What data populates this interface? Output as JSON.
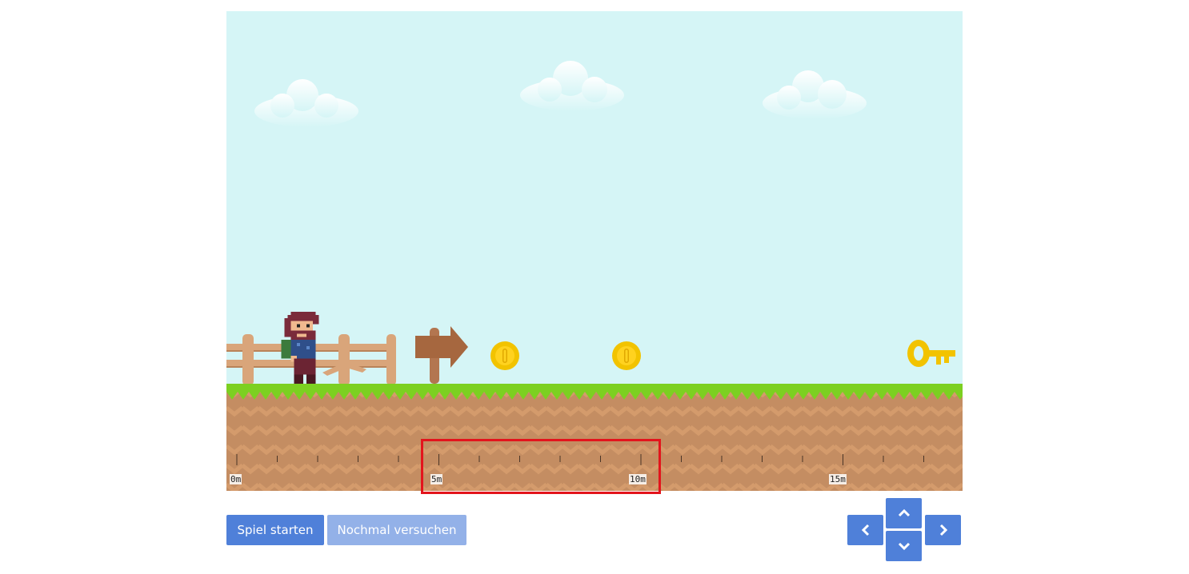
{
  "game": {
    "ruler": {
      "unit": "m",
      "labels": [
        {
          "text": "0m",
          "value": 0
        },
        {
          "text": "5m",
          "value": 5
        },
        {
          "text": "10m",
          "value": 10
        },
        {
          "text": "15m",
          "value": 15
        }
      ]
    },
    "objects": [
      {
        "icon": "player-character-icon",
        "position_m": 1.5
      },
      {
        "icon": "fence-icon"
      },
      {
        "icon": "arrow-sign-icon"
      },
      {
        "icon": "coin-icon",
        "position_m": 6.7
      },
      {
        "icon": "coin-icon",
        "position_m": 9.7
      },
      {
        "icon": "key-icon",
        "position_m": 17.4
      }
    ],
    "highlight_color": "#e3141c",
    "sky_color": "#d5f5f6",
    "grass_color": "#7cd021",
    "dirt_color": "#c48d62"
  },
  "controls": {
    "start_label": "Spiel starten",
    "retry_label": "Nochmal versuchen",
    "retry_disabled": true,
    "arrows": [
      "chevron-left-icon",
      "chevron-up-icon",
      "chevron-down-icon",
      "chevron-right-icon"
    ]
  },
  "colors": {
    "button": "#4f80d9",
    "button_disabled": "#93b1e8"
  }
}
